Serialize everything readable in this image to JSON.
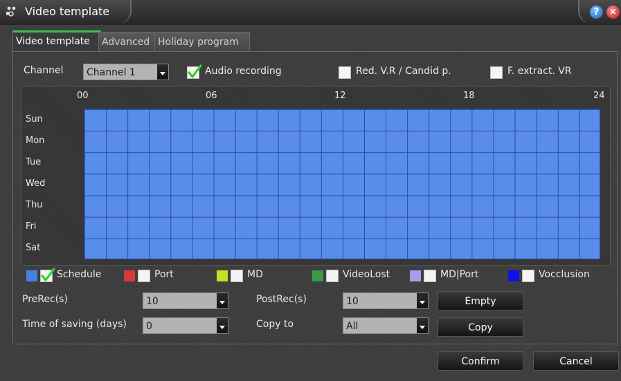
{
  "window": {
    "title": "Video template"
  },
  "tabs": [
    {
      "label": "Video template"
    },
    {
      "label": "Advanced"
    },
    {
      "label": "Holiday program"
    }
  ],
  "channel": {
    "label": "Channel",
    "value": "Channel 1"
  },
  "checks": {
    "audio": {
      "label": "Audio recording",
      "checked": true
    },
    "red": {
      "label": "Red. V.R / Candid p.",
      "checked": false
    },
    "fextract": {
      "label": "F. extract. VR",
      "checked": false
    }
  },
  "schedule": {
    "hours": [
      "00",
      "06",
      "12",
      "18",
      "24"
    ],
    "days": [
      "Sun",
      "Mon",
      "Tue",
      "Wed",
      "Thu",
      "Fri",
      "Sat"
    ],
    "fill_color": "#5a8cea"
  },
  "legend": [
    {
      "label": "Schedule",
      "color": "#4a7fe0",
      "checked": true
    },
    {
      "label": "Port",
      "color": "#d8393a",
      "checked": false
    },
    {
      "label": "MD",
      "color": "#c8e020",
      "checked": false
    },
    {
      "label": "VideoLost",
      "color": "#3a9a48",
      "checked": false
    },
    {
      "label": "MD|Port",
      "color": "#a59ee8",
      "checked": false
    },
    {
      "label": "Vocclusion",
      "color": "#1010e8",
      "checked": false
    }
  ],
  "prerec": {
    "label": "PreRec(s)",
    "value": "10"
  },
  "postrec": {
    "label": "PostRec(s)",
    "value": "10"
  },
  "saving": {
    "label": "Time of saving (days)",
    "value": "0"
  },
  "copyto": {
    "label": "Copy to",
    "value": "All"
  },
  "buttons": {
    "empty": "Empty",
    "copy": "Copy",
    "confirm": "Confirm",
    "cancel": "Cancel"
  },
  "colors": {
    "accent_tab": "#43c04a",
    "check_green": "#2fd12f"
  }
}
